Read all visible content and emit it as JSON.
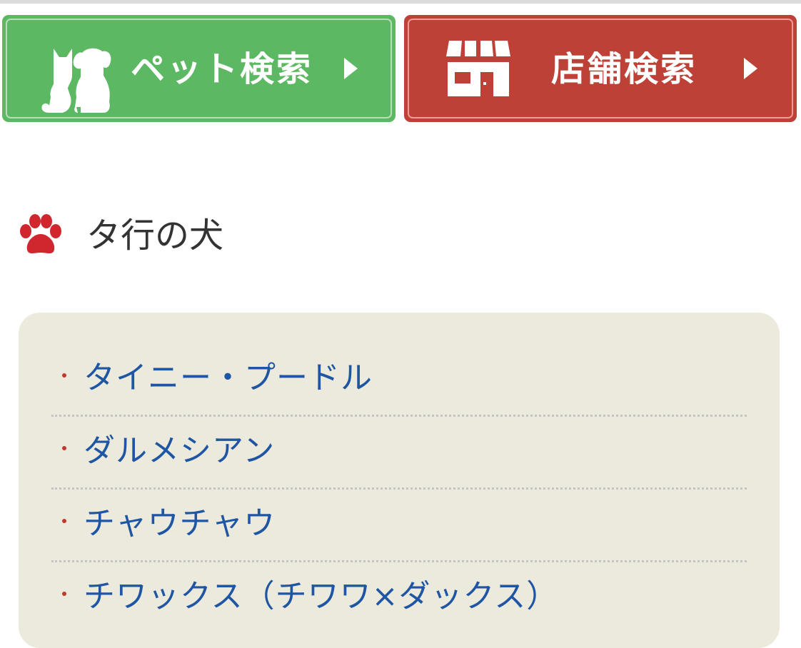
{
  "buttons": {
    "pet_search": {
      "label": "ペット検索",
      "icon": "dog-cat-icon",
      "color": "#5cb862"
    },
    "shop_search": {
      "label": "店舗検索",
      "icon": "shop-icon",
      "color": "#bd4137"
    }
  },
  "section": {
    "title": "タ行の犬",
    "icon": "paw-icon",
    "icon_color": "#d0272f"
  },
  "breeds": [
    "タイニー・プードル",
    "ダルメシアン",
    "チャウチャウ",
    "チワックス（チワワ×ダックス）"
  ],
  "colors": {
    "link": "#1f56a3",
    "bullet": "#c0392b",
    "list_background": "#ece9dd"
  }
}
